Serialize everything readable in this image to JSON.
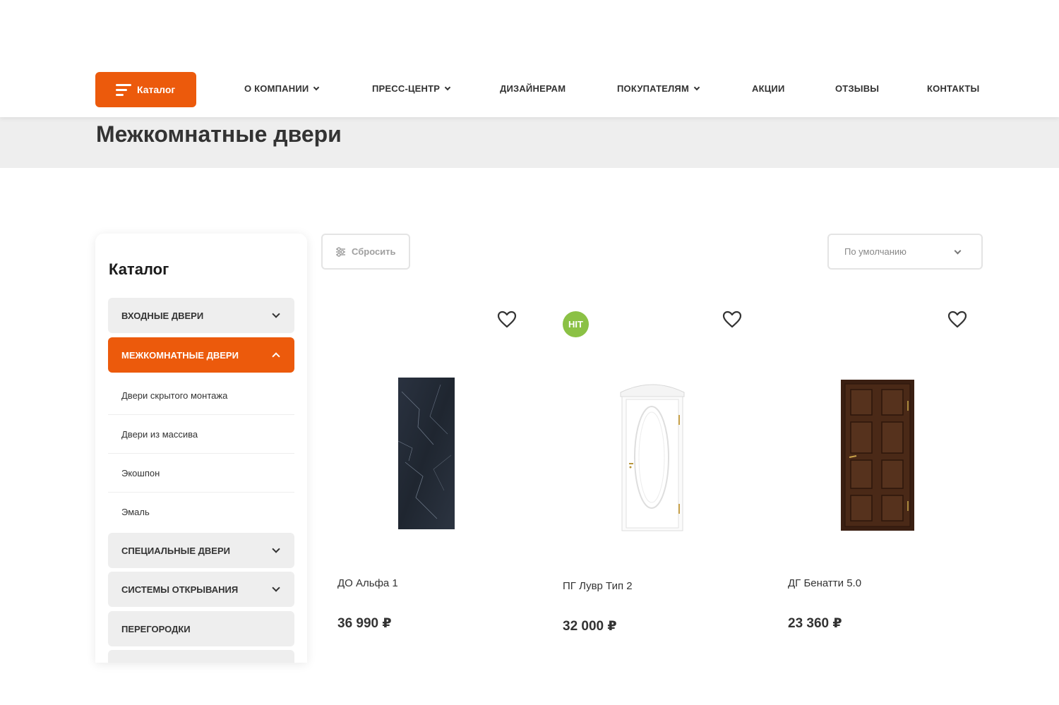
{
  "header": {
    "catalog_label": "Каталог",
    "nav": [
      {
        "label": "О КОМПАНИИ"
      },
      {
        "label": "ПРЕСС-ЦЕНТР"
      },
      {
        "label": "ДИЗАЙНЕРАМ"
      },
      {
        "label": "ПОКУПАТЕЛЯМ"
      },
      {
        "label": "АКЦИИ"
      },
      {
        "label": "ОТЗЫВЫ"
      },
      {
        "label": "КОНТАКТЫ"
      }
    ]
  },
  "page_title": "Межкомнатные двери",
  "sidebar": {
    "title": "Каталог",
    "categories": [
      {
        "label": "ВХОДНЫЕ ДВЕРИ",
        "expanded": false
      },
      {
        "label": "МЕЖКОМНАТНЫЕ ДВЕРИ",
        "expanded": true
      },
      {
        "label": "СПЕЦИАЛЬНЫЕ ДВЕРИ",
        "expanded": false
      },
      {
        "label": "СИСТЕМЫ ОТКРЫВАНИЯ",
        "expanded": false
      },
      {
        "label": "ПЕРЕГОРОДКИ",
        "expanded": false
      }
    ],
    "subcategories": [
      {
        "label": "Двери скрытого монтажа"
      },
      {
        "label": "Двери из массива"
      },
      {
        "label": "Экошпон"
      },
      {
        "label": "Эмаль"
      }
    ]
  },
  "toolbar": {
    "reset_label": "Сбросить",
    "sort_value": "По умолчанию"
  },
  "products": [
    {
      "name": "ДО Альфа 1",
      "price": "36 990 ₽",
      "badge": null,
      "image": "dark-marble-door",
      "favorite": false
    },
    {
      "name": "ПГ Лувр Тип 2",
      "price": "32 000 ₽",
      "badge": "HIT",
      "image": "white-arched-door",
      "favorite": false
    },
    {
      "name": "ДГ Бенатти 5.0",
      "price": "23 360 ₽",
      "badge": null,
      "image": "dark-wood-panel-door",
      "favorite": false
    }
  ],
  "colors": {
    "accent": "#ec5a0c",
    "badge_hit": "#8bc145",
    "title_band": "#eeeeee",
    "text": "#333333"
  }
}
